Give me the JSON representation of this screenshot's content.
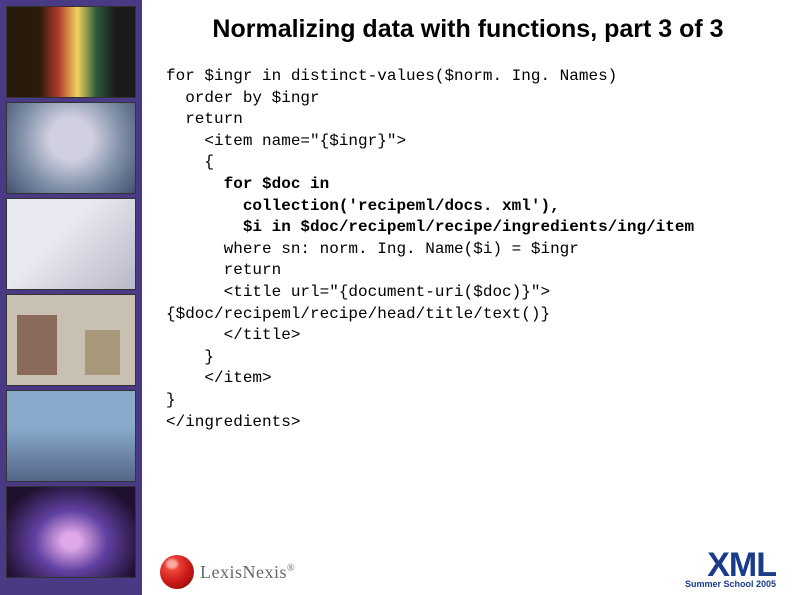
{
  "title": "Normalizing data with functions, part 3 of 3",
  "code": {
    "l1": "for $ingr in distinct-values($norm. Ing. Names)",
    "l2": "  order by $ingr",
    "l3": "  return",
    "l4": "    <item name=\"{$ingr}\">",
    "l5": "    {",
    "l6a": "      ",
    "l6b": "for $doc in",
    "l7a": "        ",
    "l7b": "collection('recipeml/docs. xml'),",
    "l8a": "        ",
    "l8b": "$i in $doc/recipeml/recipe/ingredients/ing/item",
    "l9": "      where sn: norm. Ing. Name($i) = $ingr",
    "l10": "      return",
    "l11": "      <title url=\"{document-uri($doc)}\">",
    "l12": "{$doc/recipeml/recipe/head/title/text()}",
    "l13": "      </title>",
    "l14": "    }",
    "l15": "    </item>",
    "l16": "}",
    "l17": "</ingredients>"
  },
  "footer": {
    "lexis": "LexisNexis",
    "lexis_r": "®",
    "xml_big": "XML",
    "xml_sub": "Summer School 2005"
  }
}
